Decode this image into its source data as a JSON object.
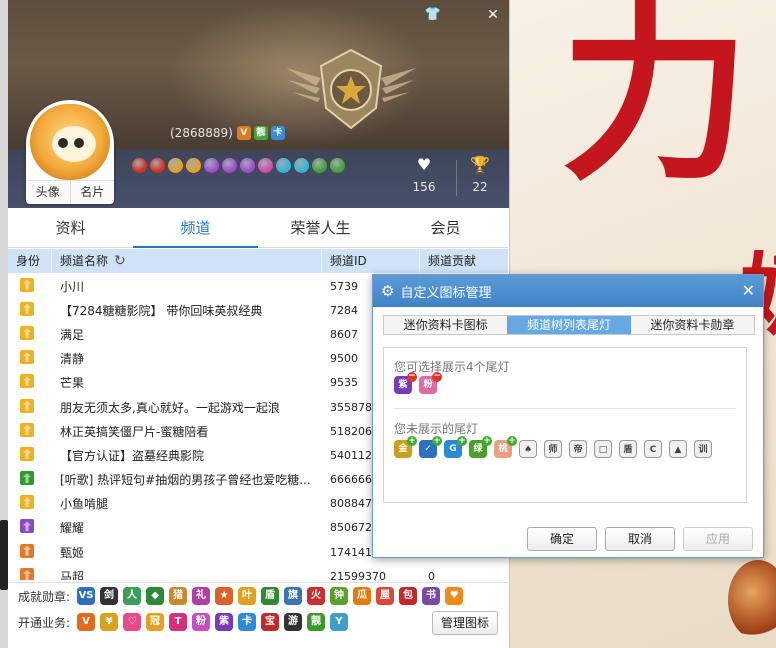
{
  "window": {
    "skin_icon": "shirt-icon",
    "close_icon": "close-icon",
    "close_glyph": "✕",
    "skin_glyph": "👕"
  },
  "profile": {
    "uid": "(2868889)",
    "avatar_buttons": [
      "头像",
      "名片"
    ],
    "stats": [
      {
        "icon": "heart-icon",
        "glyph": "♥",
        "value": "156"
      },
      {
        "icon": "trophy-icon",
        "glyph": "🏆",
        "value": "22"
      }
    ],
    "status_icons": [
      {
        "name": "vip-level-icon",
        "text": "V",
        "color": "#e07a1f"
      },
      {
        "name": "liang-icon",
        "text": "靓",
        "color": "#46a63a"
      },
      {
        "name": "card-icon",
        "text": "卡",
        "color": "#3b8ad8"
      }
    ],
    "badge_colors": [
      "#d6301f",
      "#d6301f",
      "#e8a020",
      "#e8a020",
      "#a24bd1",
      "#a24bd1",
      "#a24bd1",
      "#d64ba3",
      "#2fb6d6",
      "#2fb6d6",
      "#3da33a",
      "#3da33a"
    ]
  },
  "tabs": [
    {
      "label": "资料",
      "active": false
    },
    {
      "label": "频道",
      "active": true
    },
    {
      "label": "荣誉人生",
      "active": false
    },
    {
      "label": "会员",
      "active": false
    }
  ],
  "table": {
    "headers": [
      "身份",
      "频道名称",
      "频道ID",
      "频道贡献"
    ],
    "rows": [
      {
        "role_color": "#f0b020",
        "name": "小川",
        "id": "5739",
        "contribution": ""
      },
      {
        "role_color": "#f0b020",
        "name": "【7284糖糖影院】 带你回味英叔经典",
        "id": "7284",
        "contribution": ""
      },
      {
        "role_color": "#f0b020",
        "name": "满足",
        "id": "8607",
        "contribution": ""
      },
      {
        "role_color": "#f0b020",
        "name": "清静",
        "id": "9500",
        "contribution": ""
      },
      {
        "role_color": "#f0b020",
        "name": "芒果",
        "id": "9535",
        "contribution": ""
      },
      {
        "role_color": "#f0b020",
        "name": "朋友无须太多,真心就好。一起游戏一起浪",
        "id": "355878",
        "contribution": ""
      },
      {
        "role_color": "#f0b020",
        "name": "林正英搞笑僵尸片-蜜糖陪看",
        "id": "518206",
        "contribution": ""
      },
      {
        "role_color": "#f0b020",
        "name": "【官方认证】盗墓经典影院",
        "id": "540112",
        "contribution": ""
      },
      {
        "role_color": "#2e9d2e",
        "name": "[听歌] 热评短句#抽烟的男孩子曾经也爱吃糖...",
        "id": "666666",
        "contribution": ""
      },
      {
        "role_color": "#f0b020",
        "name": "小鱼啃腿",
        "id": "808847",
        "contribution": ""
      },
      {
        "role_color": "#8a4ac2",
        "name": "耀耀",
        "id": "850672",
        "contribution": ""
      },
      {
        "role_color": "#e07a2a",
        "name": "甄姬",
        "id": "17414113",
        "contribution": ""
      },
      {
        "role_color": "#e07a2a",
        "name": "马超",
        "id": "21599370",
        "contribution": "0"
      }
    ]
  },
  "bottom": {
    "medals_label": "成就勋章:",
    "medals": [
      {
        "name": "vs-medal-icon",
        "text": "VS",
        "color": "#2f6fc2"
      },
      {
        "name": "sword-medal-icon",
        "text": "剑",
        "color": "#333333"
      },
      {
        "name": "character-medal-icon",
        "text": "人",
        "color": "#3c9c5a"
      },
      {
        "name": "diamond-medal-icon",
        "text": "◆",
        "color": "#2d8a3a"
      },
      {
        "name": "hunter-medal-icon",
        "text": "猎",
        "color": "#c9882a"
      },
      {
        "name": "gift-medal-icon",
        "text": "礼",
        "color": "#b53ea4"
      },
      {
        "name": "star-medal-icon",
        "text": "★",
        "color": "#d9632b"
      },
      {
        "name": "leaf-medal-icon",
        "text": "叶",
        "color": "#e3a21b"
      },
      {
        "name": "shield-medal-icon",
        "text": "盾",
        "color": "#2f8a2f"
      },
      {
        "name": "flag-medal-icon",
        "text": "旗",
        "color": "#3a73b6"
      },
      {
        "name": "fire-medal-icon",
        "text": "火",
        "color": "#c83030"
      },
      {
        "name": "clock-medal-icon",
        "text": "钟",
        "color": "#5aa02a"
      },
      {
        "name": "pumpkin-medal-icon",
        "text": "瓜",
        "color": "#e37a12"
      },
      {
        "name": "house-medal-icon",
        "text": "屋",
        "color": "#d9483b"
      },
      {
        "name": "present-medal-icon",
        "text": "包",
        "color": "#c22a2a"
      },
      {
        "name": "book-medal-icon",
        "text": "书",
        "color": "#7b4aa8"
      },
      {
        "name": "heart-medal-icon",
        "text": "♥",
        "color": "#f08a1a"
      }
    ],
    "services_label": "开通业务:",
    "services": [
      {
        "name": "v-service-icon",
        "text": "V",
        "color": "#e36a1a"
      },
      {
        "name": "coin-service-icon",
        "text": "¥",
        "color": "#d9a21b"
      },
      {
        "name": "heart-service-icon",
        "text": "♡",
        "color": "#e64c8a"
      },
      {
        "name": "crown-service-icon",
        "text": "冠",
        "color": "#e8a020"
      },
      {
        "name": "t-service-icon",
        "text": "T",
        "color": "#d6307a"
      },
      {
        "name": "fan-service-icon",
        "text": "粉",
        "color": "#c94cc2"
      },
      {
        "name": "purple-service-icon",
        "text": "紫",
        "color": "#7a3ab6"
      },
      {
        "name": "card-service-icon",
        "text": "卡",
        "color": "#2f8ad8"
      },
      {
        "name": "gem-service-icon",
        "text": "宝",
        "color": "#c22a2a"
      },
      {
        "name": "game-service-icon",
        "text": "游",
        "color": "#333333"
      },
      {
        "name": "liang-service-icon",
        "text": "靓",
        "color": "#3c9a2a"
      },
      {
        "name": "vx-service-icon",
        "text": "Y",
        "color": "#3ca0c8"
      }
    ],
    "manage_button": "管理图标"
  },
  "dialog": {
    "title": "自定义图标管理",
    "gear_glyph": "⚙",
    "close_glyph": "✕",
    "tabs": [
      {
        "label": "迷你资料卡图标",
        "active": false
      },
      {
        "label": "频道树列表尾灯",
        "active": true
      },
      {
        "label": "迷你资料卡勋章",
        "active": false
      }
    ],
    "selectable_label": "您可选择展示4个尾灯",
    "shown_lights": [
      {
        "name": "purple-taillight-icon",
        "text": "紫",
        "color": "#7a3ab6"
      },
      {
        "name": "pink-taillight-icon",
        "text": "粉",
        "color": "#e06aa4"
      }
    ],
    "hidden_label": "您未展示的尾灯",
    "hidden_lights": [
      {
        "name": "gold-taillight-icon",
        "text": "金",
        "color": "#c9a21b",
        "gray": false
      },
      {
        "name": "blue-taillight-icon",
        "text": "✓",
        "color": "#2f6fc2",
        "gray": false
      },
      {
        "name": "g-taillight-icon",
        "text": "G",
        "color": "#2a8ad8",
        "gray": false
      },
      {
        "name": "green-taillight-icon",
        "text": "绿",
        "color": "#4aa02a",
        "gray": false
      },
      {
        "name": "peach-taillight-icon",
        "text": "桃",
        "color": "#e8a080",
        "gray": false
      },
      {
        "name": "spade-taillight-icon",
        "text": "♠",
        "color": "#555555",
        "gray": true
      },
      {
        "name": "shi-taillight-icon",
        "text": "师",
        "color": "#555555",
        "gray": true
      },
      {
        "name": "di-taillight-icon",
        "text": "帝",
        "color": "#555555",
        "gray": true
      },
      {
        "name": "monitor-taillight-icon",
        "text": "□",
        "color": "#555555",
        "gray": true
      },
      {
        "name": "shield-taillight-icon",
        "text": "盾",
        "color": "#555555",
        "gray": true
      },
      {
        "name": "c-taillight-icon",
        "text": "C",
        "color": "#555555",
        "gray": true
      },
      {
        "name": "triangle-taillight-icon",
        "text": "▲",
        "color": "#555555",
        "gray": true
      },
      {
        "name": "xun-taillight-icon",
        "text": "训",
        "color": "#555555",
        "gray": true
      }
    ],
    "ok": "确定",
    "cancel": "取消",
    "apply": "应用"
  },
  "background": {
    "glyph_main": "力",
    "glyph_side": "奶"
  }
}
